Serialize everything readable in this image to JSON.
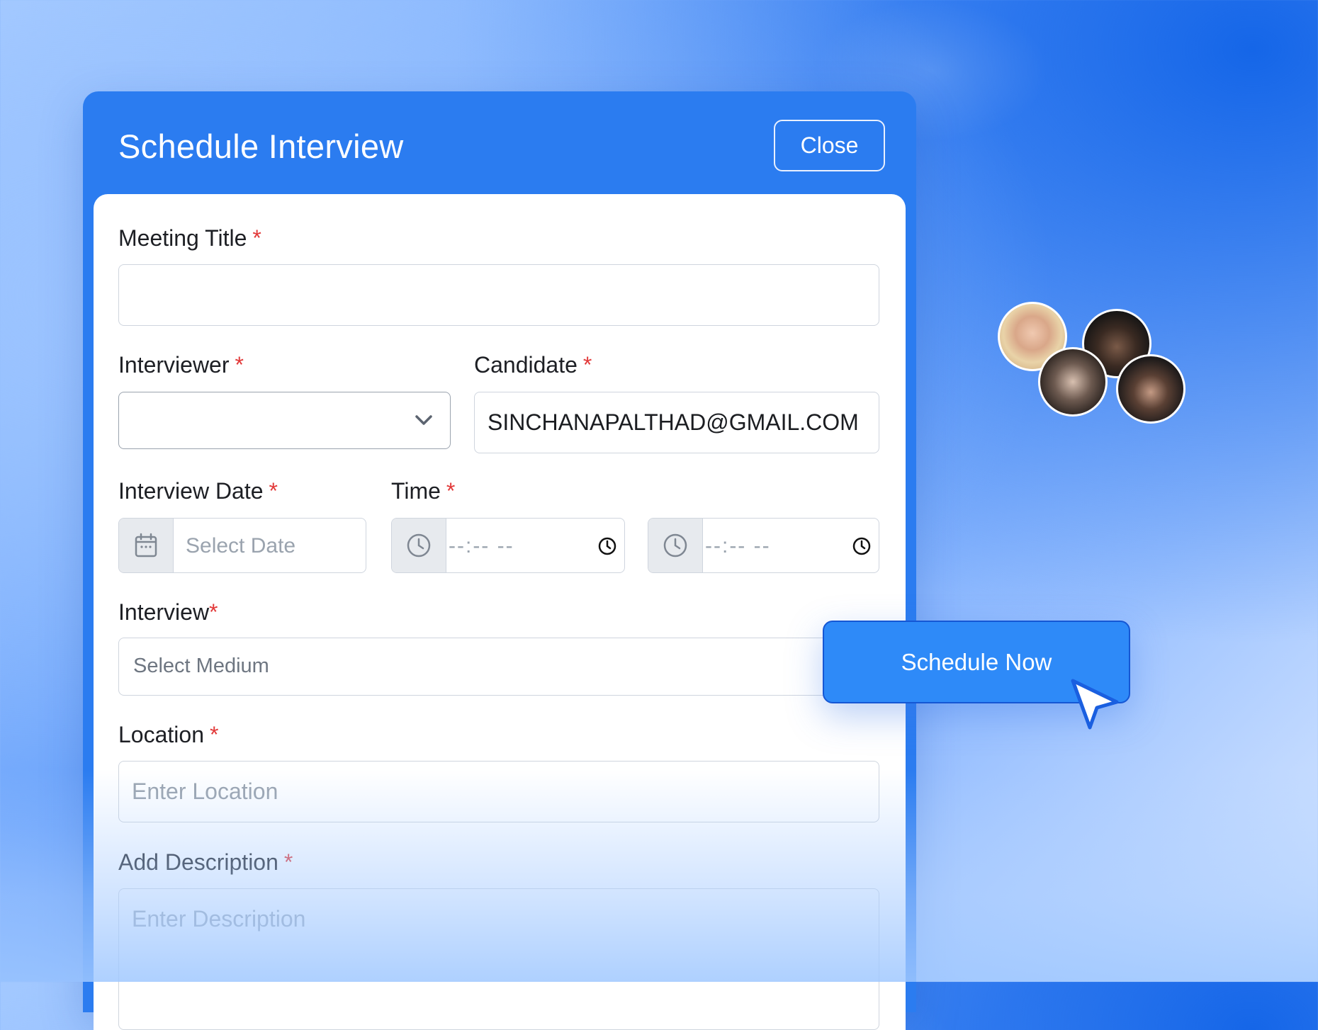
{
  "modal": {
    "title": "Schedule Interview",
    "close_label": "Close"
  },
  "form": {
    "meeting_title": {
      "label": "Meeting Title",
      "required": "*",
      "value": ""
    },
    "interviewer": {
      "label": "Interviewer",
      "required": "*",
      "value": ""
    },
    "candidate": {
      "label": "Candidate",
      "required": "*",
      "value": "SINCHANAPALTHAD@GMAIL.COM"
    },
    "interview_date": {
      "label": "Interview Date",
      "required": "*",
      "placeholder": "Select Date"
    },
    "time": {
      "label": "Time",
      "required": "*",
      "start_placeholder": "--:-- --",
      "end_placeholder": "--:-- --"
    },
    "interview_medium": {
      "label": "Interview",
      "required": "*",
      "placeholder": "Select Medium"
    },
    "location": {
      "label": "Location",
      "required": "*",
      "placeholder": "Enter Location"
    },
    "description": {
      "label": "Add Description",
      "required": "*",
      "placeholder": "Enter Description"
    }
  },
  "cta": {
    "label": "Schedule Now"
  },
  "icons": {
    "dropdown": "chevron-down-icon",
    "date": "calendar-icon",
    "time": "clock-icon",
    "cursor": "pointer-cursor-icon"
  },
  "colors": {
    "modal_header": "#2b7cf0",
    "primary_button": "#2e8af8",
    "required_marker": "#e23a3a"
  }
}
